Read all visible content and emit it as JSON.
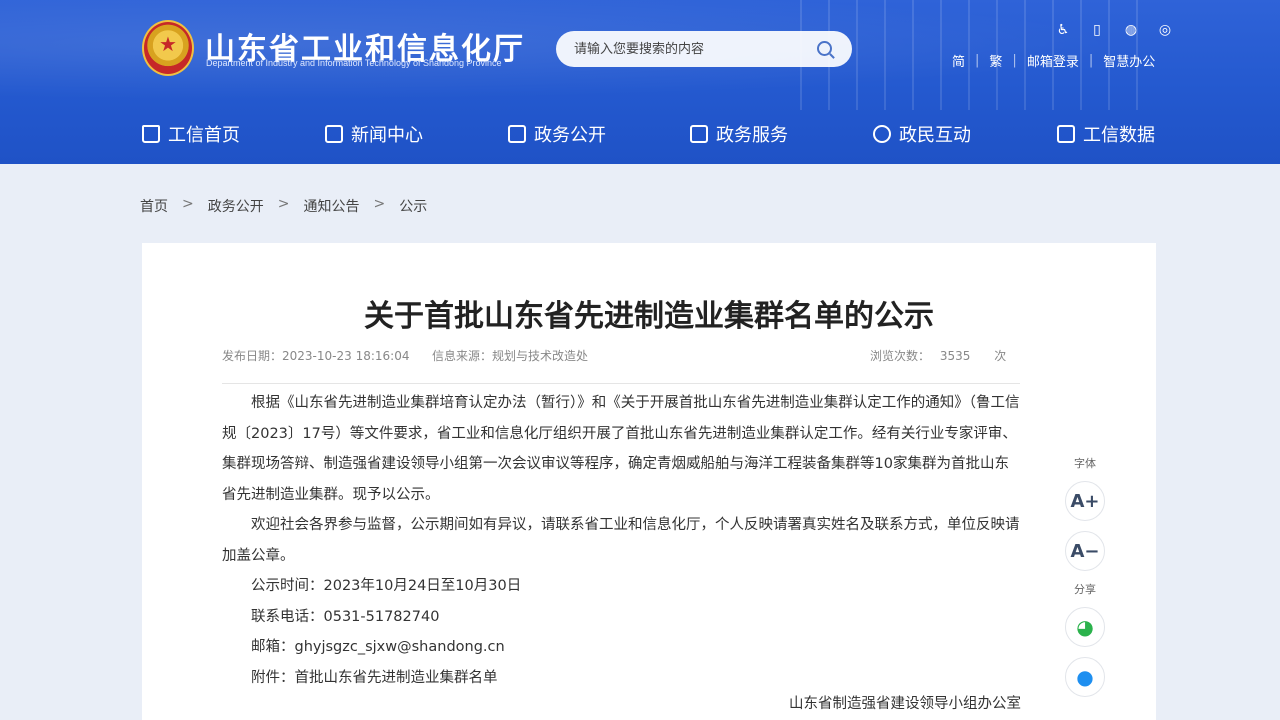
{
  "header": {
    "title": "山东省工业和信息化厅",
    "subtitle": "Department of Industry and Information Technology of Shandong Province",
    "search_placeholder": "请输入您要搜索的内容",
    "tool_icons": [
      "accessibility-icon",
      "mobile-icon",
      "wechat-icon",
      "weibo-icon"
    ],
    "links": {
      "simplified": "简",
      "traditional": "繁",
      "mail": "邮箱登录",
      "office": "智慧办公"
    }
  },
  "nav": [
    {
      "label": "工信首页",
      "icon": "home-icon"
    },
    {
      "label": "新闻中心",
      "icon": "news-icon"
    },
    {
      "label": "政务公开",
      "icon": "monitor-icon"
    },
    {
      "label": "政务服务",
      "icon": "service-icon"
    },
    {
      "label": "政民互动",
      "icon": "chat-icon"
    },
    {
      "label": "工信数据",
      "icon": "database-icon"
    }
  ],
  "breadcrumb": [
    "首页",
    "政务公开",
    "通知公告",
    "公示"
  ],
  "article": {
    "title": "关于首批山东省先进制造业集群名单的公示",
    "date_label": "发布日期：",
    "date": "2023-10-23 18:16:04",
    "source_label": "信息来源：",
    "source": "规划与技术改造处",
    "views_label": "浏览次数：",
    "views": "3535",
    "views_unit": "次",
    "paragraphs": [
      "根据《山东省先进制造业集群培育认定办法（暂行）》和《关于开展首批山东省先进制造业集群认定工作的通知》（鲁工信规〔2023〕17号）等文件要求，省工业和信息化厅组织开展了首批山东省先进制造业集群认定工作。经有关行业专家评审、集群现场答辩、制造强省建设领导小组第一次会议审议等程序，确定青烟威船舶与海洋工程装备集群等10家集群为首批山东省先进制造业集群。现予以公示。",
      "欢迎社会各界参与监督，公示期间如有异议，请联系省工业和信息化厅，个人反映请署真实姓名及联系方式，单位反映请加盖公章。",
      "公示时间：2023年10月24日至10月30日",
      "联系电话：0531-51782740",
      "邮箱：ghyjsgzc_sjxw@shandong.cn",
      "附件：首批山东省先进制造业集群名单"
    ],
    "signature": "山东省制造强省建设领导小组办公室"
  },
  "side": {
    "font_label": "字体",
    "font_increase": "A+",
    "font_decrease": "A−",
    "share_label": "分享"
  }
}
